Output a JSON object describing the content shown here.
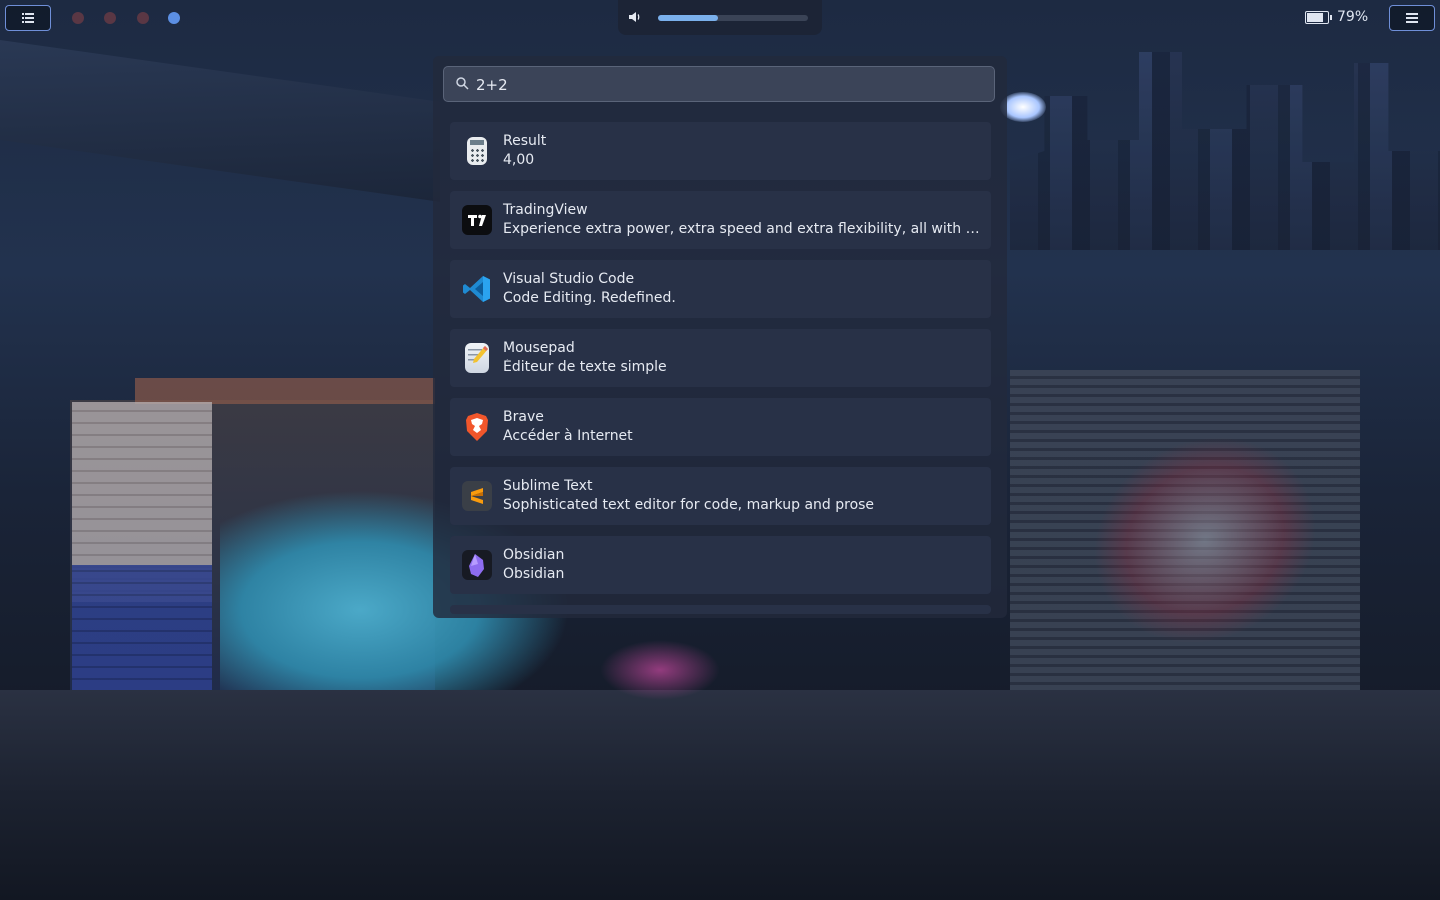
{
  "panel": {
    "apps_icon": "list-icon",
    "menu_icon": "hamburger-menu-icon",
    "workspaces": [
      {
        "active": false
      },
      {
        "active": false
      },
      {
        "active": false
      },
      {
        "active": true
      }
    ],
    "volume": {
      "icon": "speaker-icon",
      "level": 0.4
    },
    "battery": {
      "icon": "battery-icon",
      "percent_label": "79%",
      "level": 0.79
    }
  },
  "launcher": {
    "search": {
      "value": "2+2",
      "icon": "search-icon"
    },
    "results": [
      {
        "title": "Result",
        "description": "4,00",
        "icon": "calculator-icon"
      },
      {
        "title": "TradingView",
        "description": "Experience extra power, extra speed and extra flexibility, all with the sa…",
        "icon": "tradingview-icon"
      },
      {
        "title": "Visual Studio Code",
        "description": "Code Editing. Redefined.",
        "icon": "vscode-icon"
      },
      {
        "title": "Mousepad",
        "description": "Éditeur de texte simple",
        "icon": "mousepad-icon"
      },
      {
        "title": "Brave",
        "description": "Accéder à Internet",
        "icon": "brave-icon"
      },
      {
        "title": "Sublime Text",
        "description": "Sophisticated text editor for code, markup and prose",
        "icon": "sublime-text-icon"
      },
      {
        "title": "Obsidian",
        "description": "Obsidian",
        "icon": "obsidian-icon"
      }
    ]
  },
  "colors": {
    "accent": "#5c8fe3",
    "panel_border": "#6f8fd8",
    "row_bg": "#283147",
    "launcher_bg": "#222a3c"
  }
}
